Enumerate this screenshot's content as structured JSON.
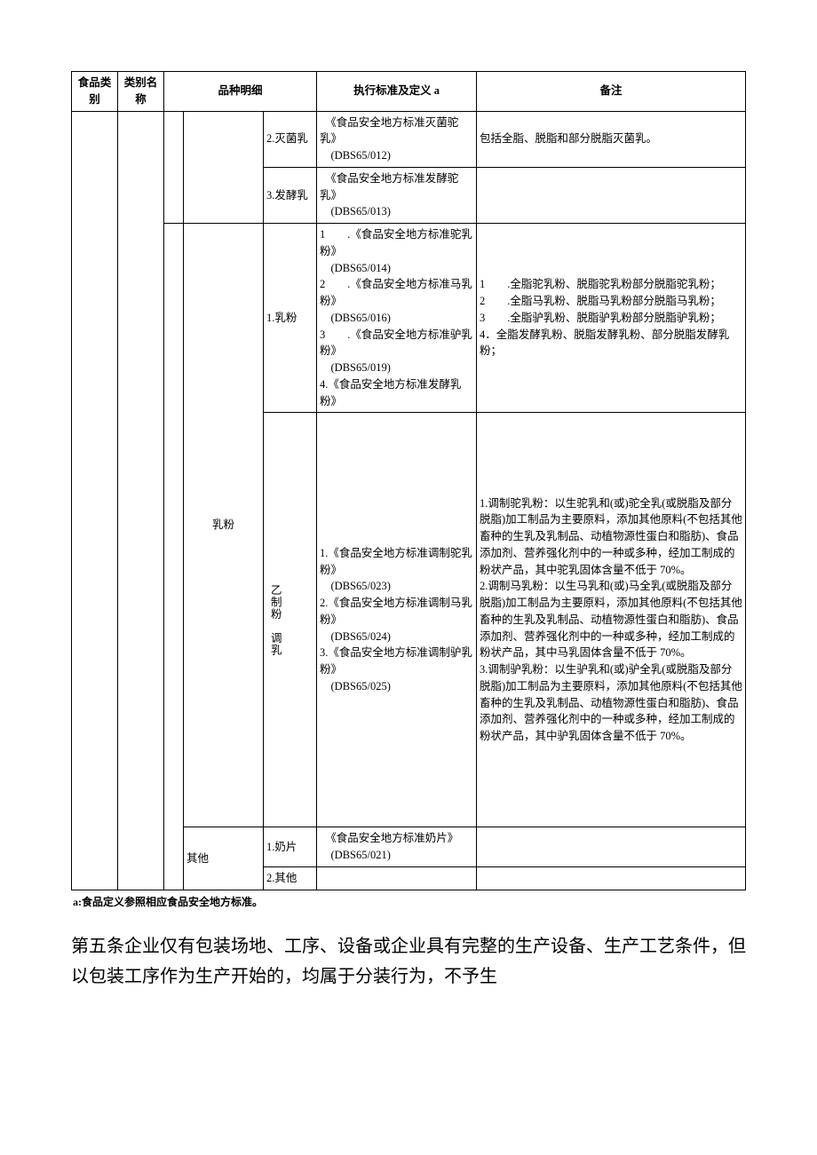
{
  "headers": {
    "category": "食品类别",
    "name": "类别名称",
    "variety": "品种明细",
    "standard": "执行标准及定义 a",
    "remark": "备注"
  },
  "col3b_header_sub": "乳粉",
  "vert_label": "乙制粉　调乳",
  "rows": {
    "r1": {
      "variety_c": "2.灭菌乳",
      "standard": "　《食品安全地方标准灭菌驼乳》\n　(DBS65/012)",
      "remark": "包括全脂、脱脂和部分脱脂灭菌乳。"
    },
    "r2": {
      "variety_c": "3.发酵乳",
      "standard": "　《食品安全地方标准发酵驼乳》\n　(DBS65/013)",
      "remark": ""
    },
    "r3": {
      "variety_c": "1.乳粉",
      "standard": "1　　.《食品安全地方标准驼乳粉》\n　(DBS65/014)\n2　　.《食品安全地方标准马乳粉》\n　(DBS65/016)\n3　　.《食品安全地方标准驴乳粉》\n　(DBS65/019)\n4.《食品安全地方标准发酵乳粉》",
      "remark": "1　　.全脂驼乳粉、脱脂驼乳粉部分脱脂驼乳粉；\n2　　.全脂马乳粉、脱脂马乳粉部分脱脂马乳粉；\n3　　.全脂驴乳粉、脱脂驴乳粉部分脱脂驴乳粉；\n4．全脂发酵乳粉、脱脂发酵乳粉、部分脱脂发酵乳粉；"
    },
    "r4": {
      "standard": "1.《食品安全地方标准调制驼乳粉》\n　(DBS65/023)\n2.《食品安全地方标准调制马乳粉》\n　(DBS65/024)\n3.《食品安全地方标准调制驴乳粉》\n　(DBS65/025)",
      "remark": "1.调制驼乳粉：以生驼乳和(或)驼全乳(或脱脂及部分脱脂)加工制品为主要原料，添加其他原料(不包括其他畜种的生乳及乳制品、动植物源性蛋白和脂肪)、食品添加剂、营养强化剂中的一种或多种，经加工制成的粉状产品，其中驼乳固体含量不低于 70%。\n2.调制马乳粉：以生马乳和(或)马全乳(或脱脂及部分脱脂)加工制品为主要原料，添加其他原料(不包括其他畜种的生乳及乳制品、动植物源性蛋白和脂肪)、食品添加剂、营养强化剂中的一种或多种，经加工制成的粉状产品，其中马乳固体含量不低于 70%。\n3.调制驴乳粉：以生驴乳和(或)驴全乳(或脱脂及部分脱脂)加工制品为主要原料，添加其他原料(不包括其他畜种的生乳及乳制品、动植物源性蛋白和脂肪)、食品添加剂、营养强化剂中的一种或多种，经加工制成的粉状产品，其中驴乳固体含量不低于 70%。"
    },
    "r5": {
      "variety_b": "其他",
      "variety_c": "1.奶片",
      "standard": "　《食品安全地方标准奶片》\n　(DBS65/021)",
      "remark": ""
    },
    "r6": {
      "variety_c": "2.其他",
      "standard": "",
      "remark": ""
    }
  },
  "footnote": "a:食品定义参照相应食品安全地方标准。",
  "paragraph": "第五条企业仅有包装场地、工序、设备或企业具有完整的生产设备、生产工艺条件，但以包装工序作为生产开始的，均属于分装行为，不予生"
}
